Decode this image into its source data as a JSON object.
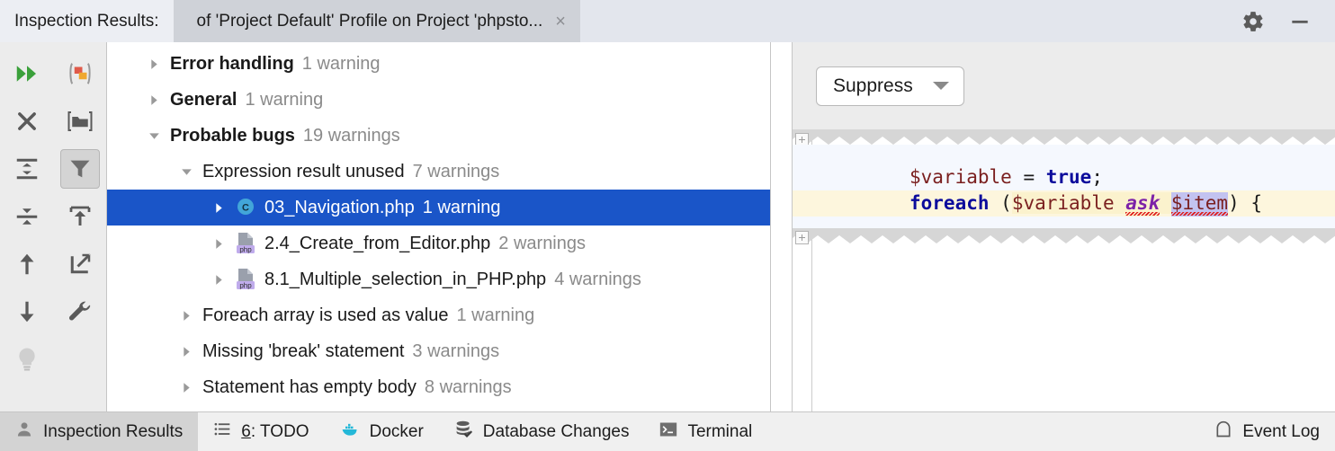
{
  "window": {
    "title": "Inspection Results:",
    "tab_label": "of 'Project Default' Profile on Project 'phpsto...",
    "close_label": "×",
    "settings_icon": "gear-icon",
    "minimize_icon": "minimize-icon"
  },
  "toolbar": {
    "items": [
      {
        "name": "rerun-inspection",
        "icon": "double-right-arrow-icon"
      },
      {
        "name": "group-by-severity",
        "icon": "grouping-icon"
      },
      {
        "name": "close-inspection",
        "icon": "close-x-icon"
      },
      {
        "name": "group-by-directory",
        "icon": "folder-icon"
      },
      {
        "name": "expand-all",
        "icon": "expand-all-icon"
      },
      {
        "name": "filter-inspections",
        "icon": "filter-icon",
        "pressed": true
      },
      {
        "name": "collapse-all",
        "icon": "collapse-all-icon"
      },
      {
        "name": "export-to-file",
        "icon": "export-icon"
      },
      {
        "name": "previous-problem",
        "icon": "arrow-up-icon"
      },
      {
        "name": "open-in-new-window",
        "icon": "open-external-icon"
      },
      {
        "name": "next-problem",
        "icon": "arrow-down-icon"
      },
      {
        "name": "edit-settings",
        "icon": "wrench-icon"
      },
      {
        "name": "quick-fix",
        "icon": "lightbulb-icon"
      }
    ]
  },
  "tree": {
    "rows": [
      {
        "label": "Error handling",
        "count": "1 warning",
        "indent": 0,
        "bold": true,
        "expanded": false,
        "icon": null,
        "selected": false
      },
      {
        "label": "General",
        "count": "1 warning",
        "indent": 0,
        "bold": true,
        "expanded": false,
        "icon": null,
        "selected": false
      },
      {
        "label": "Probable bugs",
        "count": "19 warnings",
        "indent": 0,
        "bold": true,
        "expanded": true,
        "icon": null,
        "selected": false
      },
      {
        "label": "Expression result unused",
        "count": "7 warnings",
        "indent": 1,
        "bold": false,
        "expanded": true,
        "icon": null,
        "selected": false
      },
      {
        "label": "03_Navigation.php",
        "count": "1 warning",
        "indent": 2,
        "bold": false,
        "expanded": false,
        "icon": "php-class-icon",
        "selected": true
      },
      {
        "label": "2.4_Create_from_Editor.php",
        "count": "2 warnings",
        "indent": 2,
        "bold": false,
        "expanded": false,
        "icon": "php-file-icon",
        "selected": false
      },
      {
        "label": "8.1_Multiple_selection_in_PHP.php",
        "count": "4 warnings",
        "indent": 2,
        "bold": false,
        "expanded": false,
        "icon": "php-file-icon",
        "selected": false
      },
      {
        "label": "Foreach array is used as value",
        "count": "1 warning",
        "indent": 1,
        "bold": false,
        "expanded": false,
        "icon": null,
        "selected": false
      },
      {
        "label": "Missing 'break' statement",
        "count": "3 warnings",
        "indent": 1,
        "bold": false,
        "expanded": false,
        "icon": null,
        "selected": false
      },
      {
        "label": "Statement has empty body",
        "count": "8 warnings",
        "indent": 1,
        "bold": false,
        "expanded": false,
        "icon": null,
        "selected": false
      }
    ]
  },
  "right_panel": {
    "suppress_label": "Suppress",
    "dropdown_icon": "chevron-down-icon",
    "code": {
      "line1": {
        "var": "$variable",
        "op": " = ",
        "kw": "true",
        "semi": ";"
      },
      "line2": {
        "kw": "foreach",
        "open": " (",
        "var": "$variable",
        "error": "ask",
        "item": "$item",
        "close": ") {"
      }
    }
  },
  "statusbar": {
    "items": [
      {
        "label": "Inspection Results",
        "icon": "inspection-person-icon",
        "active": true,
        "mnemonic": ""
      },
      {
        "label": ": TODO",
        "icon": "todo-list-icon",
        "active": false,
        "mnemonic": "6"
      },
      {
        "label": "Docker",
        "icon": "docker-whale-icon",
        "active": false,
        "mnemonic": ""
      },
      {
        "label": "Database Changes",
        "icon": "database-changes-icon",
        "active": false,
        "mnemonic": ""
      },
      {
        "label": "Terminal",
        "icon": "terminal-icon",
        "active": false,
        "mnemonic": ""
      }
    ],
    "right": {
      "label": "Event Log",
      "icon": "event-log-icon"
    }
  },
  "colors": {
    "selection_blue": "#1a55c8",
    "accent_green": "#3aa03a",
    "php_badge": "#b9a8e0",
    "docker_blue": "#24b8d8",
    "error_red": "#e01b1b"
  }
}
